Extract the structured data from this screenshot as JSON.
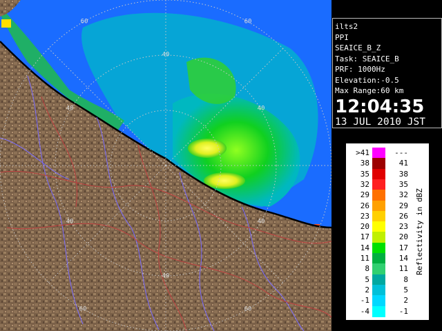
{
  "radar_display": {
    "range_ring_labels": [
      "40",
      "60"
    ]
  },
  "info_panel": {
    "site": "ilts2",
    "scan_type": "PPI",
    "product": "SEAICE_B_Z",
    "task": "Task: SEAICE_B",
    "prf": "PRF: 1000Hz",
    "elevation": "Elevation:-0.5",
    "max_range": "Max Range:60 km",
    "time": "12:04:35",
    "date": "13 JUL 2010 JST"
  },
  "legend": {
    "units_label": "Reflectivity in dBZ",
    "rows": [
      {
        "low": ">41",
        "high": "---",
        "color": "#ff00ff"
      },
      {
        "low": "38",
        "high": "41",
        "color": "#9c0000"
      },
      {
        "low": "35",
        "high": "38",
        "color": "#e00000"
      },
      {
        "low": "32",
        "high": "35",
        "color": "#ff2020"
      },
      {
        "low": "29",
        "high": "32",
        "color": "#ff7000"
      },
      {
        "low": "26",
        "high": "29",
        "color": "#ffa000"
      },
      {
        "low": "23",
        "high": "26",
        "color": "#ffd000"
      },
      {
        "low": "20",
        "high": "23",
        "color": "#ffff00"
      },
      {
        "low": "17",
        "high": "20",
        "color": "#c0f000"
      },
      {
        "low": "14",
        "high": "17",
        "color": "#00e000"
      },
      {
        "low": "11",
        "high": "14",
        "color": "#00b040"
      },
      {
        "low": "8",
        "high": "11",
        "color": "#30d070"
      },
      {
        "low": "5",
        "high": "8",
        "color": "#00a8a0"
      },
      {
        "low": "2",
        "high": "5",
        "color": "#00c0d8"
      },
      {
        "low": "-1",
        "high": "2",
        "color": "#00d8ff"
      },
      {
        "low": "-4",
        "high": "-1",
        "color": "#00ffff"
      }
    ]
  },
  "colors": {
    "sea": "#1a6cff",
    "land": "#7a6048",
    "land_light": "#b09070",
    "coastline": "#000000",
    "rivers": "#7a6cff",
    "roads": "#c04040",
    "range_rings": "#c8c8c8"
  }
}
